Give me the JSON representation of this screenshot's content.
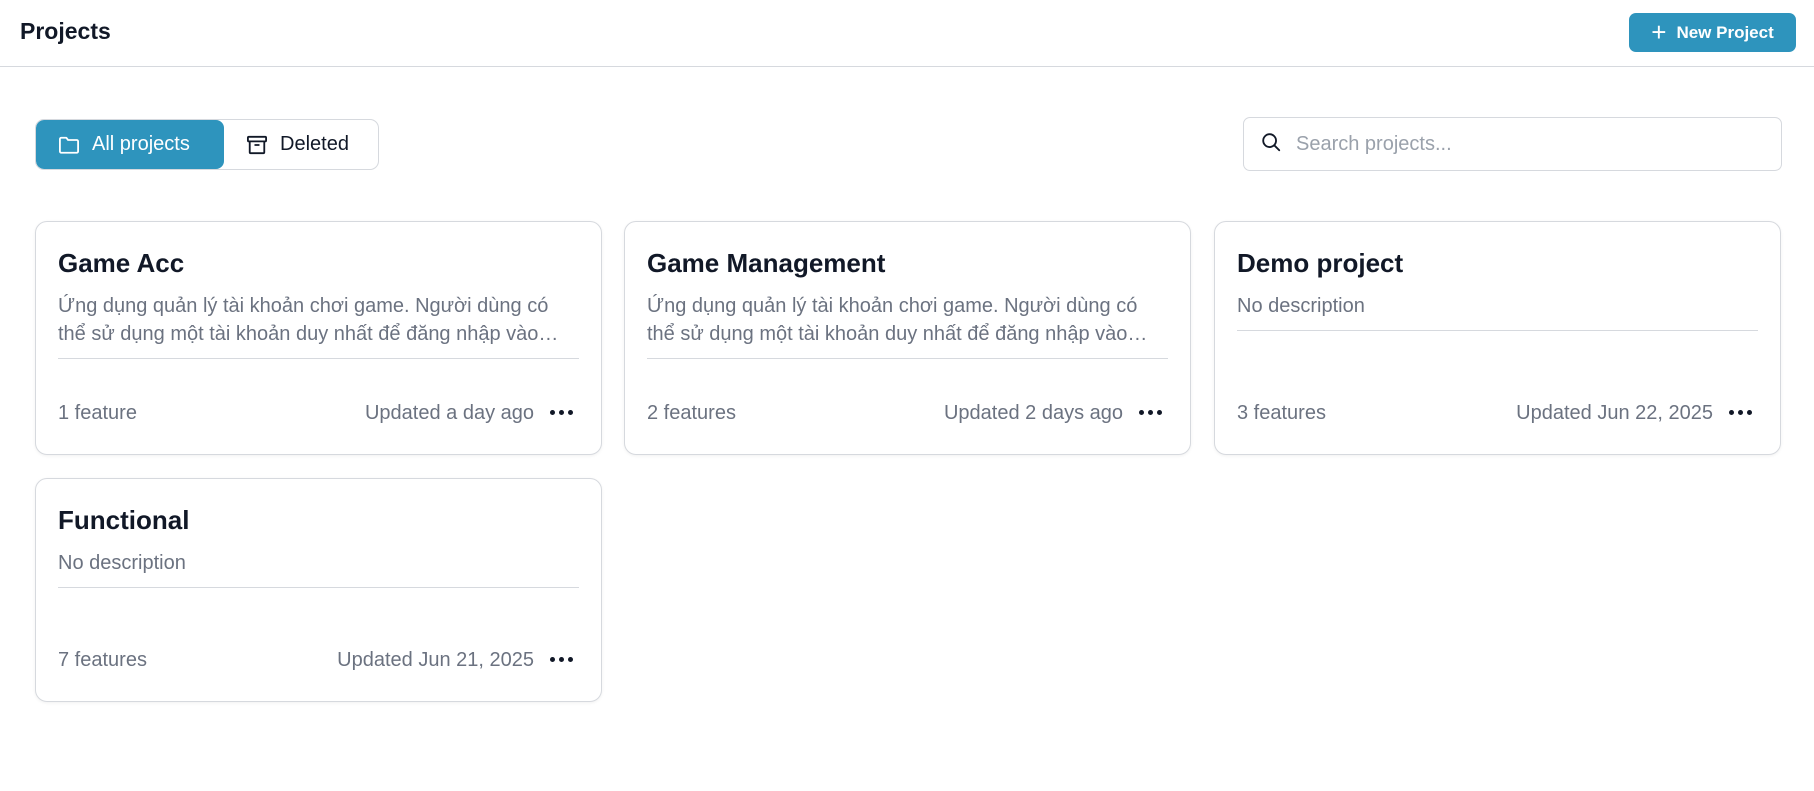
{
  "header": {
    "title": "Projects",
    "new_project_label": "New Project"
  },
  "filters": {
    "all_label": "All projects",
    "deleted_label": "Deleted"
  },
  "search": {
    "placeholder": "Search projects..."
  },
  "colors": {
    "accent": "#2e94bd"
  },
  "projects": [
    {
      "name": "Game Acc",
      "description": "Ứng dụng quản lý tài khoản chơi game. Người dùng có thể sử dụng một tài khoản duy nhất để đăng nhập vào nhiều trò chơi khác nhau.",
      "features": "1 feature",
      "updated": "Updated a day ago"
    },
    {
      "name": "Game Management",
      "description": "Ứng dụng quản lý tài khoản chơi game. Người dùng có thể sử dụng một tài khoản duy nhất để đăng nhập vào nhiều trò chơi khác nhau.",
      "features": "2 features",
      "updated": "Updated 2 days ago"
    },
    {
      "name": "Demo project",
      "description": "No description",
      "features": "3 features",
      "updated": "Updated Jun 22, 2025"
    },
    {
      "name": "Functional",
      "description": "No description",
      "features": "7 features",
      "updated": "Updated Jun 21, 2025"
    }
  ]
}
